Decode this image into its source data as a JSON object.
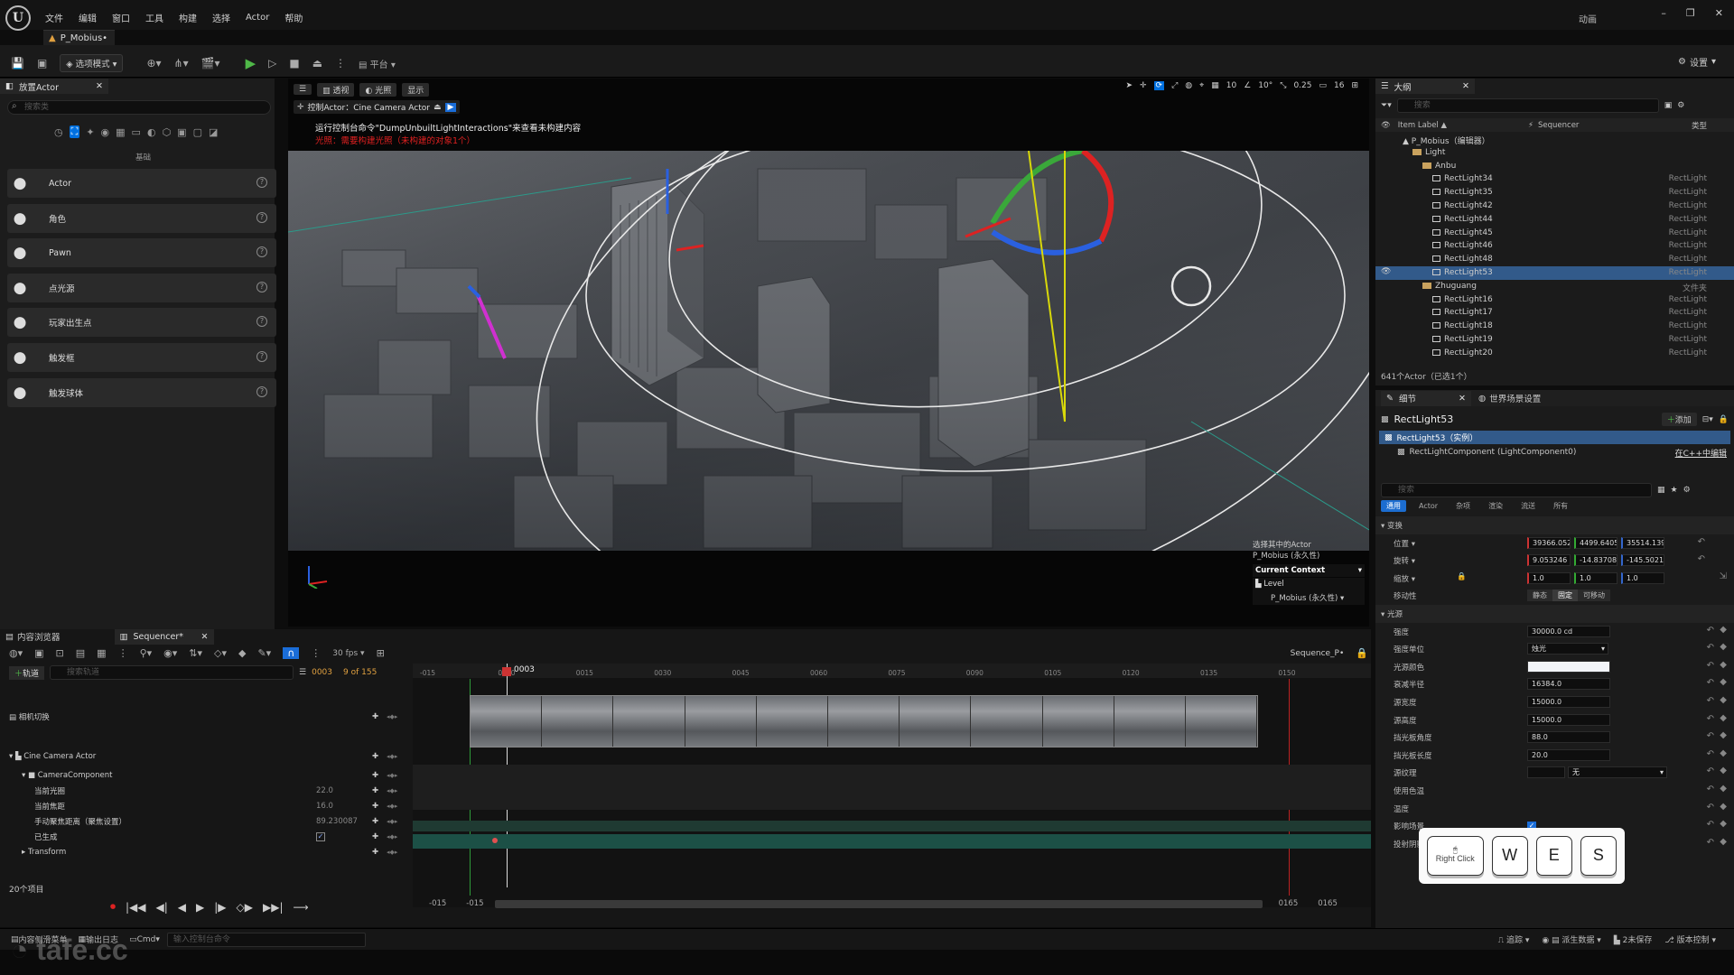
{
  "menu": [
    "文件",
    "编辑",
    "窗口",
    "工具",
    "构建",
    "选择",
    "Actor",
    "帮助"
  ],
  "doc_tab": "P_Mobius•",
  "window_mode": "动画",
  "toolbar": {
    "select_mode": "选项模式",
    "platform": "平台",
    "settings": "设置"
  },
  "place_panel": {
    "title": "放置Actor",
    "search_placeholder": "搜索类",
    "category": "基础",
    "items": [
      {
        "label": "Actor",
        "icon": "cube-icon"
      },
      {
        "label": "角色",
        "icon": "character-icon"
      },
      {
        "label": "Pawn",
        "icon": "pawn-icon"
      },
      {
        "label": "点光源",
        "icon": "point-light-icon"
      },
      {
        "label": "玩家出生点",
        "icon": "player-start-icon"
      },
      {
        "label": "触发框",
        "icon": "trigger-box-icon"
      },
      {
        "label": "触发球体",
        "icon": "trigger-sphere-icon"
      }
    ]
  },
  "viewport": {
    "perspective": "透视",
    "lit": "光照",
    "show": "显示",
    "pilot": "控制Actor：Cine Camera Actor",
    "warning": "运行控制台命令\"DumpUnbuiltLightInteractions\"来查看未构建内容",
    "error": "光照：需要构建光照（未构建的对象1个）",
    "grid": "10",
    "angle": "10°",
    "scale": "0.25",
    "camspeed": "16",
    "context": {
      "selected_title": "选择其中的Actor",
      "selected_value": "P_Mobius (永久性)",
      "header": "Current Context",
      "level_label": "Level",
      "level_value": "P_Mobius (永久性)"
    }
  },
  "outliner": {
    "title": "大纲",
    "search_placeholder": "搜索",
    "col_label": "Item Label ▲",
    "col_seq": "Sequencer",
    "col_type": "类型",
    "rows": [
      {
        "label": "P_Mobius（编辑器）",
        "type": "",
        "indent": 0,
        "kind": "world"
      },
      {
        "label": "Light",
        "type": "",
        "indent": 1,
        "kind": "folder"
      },
      {
        "label": "Anbu",
        "type": "",
        "indent": 2,
        "kind": "folder"
      },
      {
        "label": "RectLight34",
        "type": "RectLight",
        "indent": 3,
        "kind": "actor"
      },
      {
        "label": "RectLight35",
        "type": "RectLight",
        "indent": 3,
        "kind": "actor"
      },
      {
        "label": "RectLight42",
        "type": "RectLight",
        "indent": 3,
        "kind": "actor"
      },
      {
        "label": "RectLight44",
        "type": "RectLight",
        "indent": 3,
        "kind": "actor"
      },
      {
        "label": "RectLight45",
        "type": "RectLight",
        "indent": 3,
        "kind": "actor"
      },
      {
        "label": "RectLight46",
        "type": "RectLight",
        "indent": 3,
        "kind": "actor"
      },
      {
        "label": "RectLight48",
        "type": "RectLight",
        "indent": 3,
        "kind": "actor"
      },
      {
        "label": "RectLight53",
        "type": "RectLight",
        "indent": 3,
        "kind": "actor",
        "selected": true
      },
      {
        "label": "Zhuguang",
        "type": "文件夹",
        "indent": 2,
        "kind": "folder"
      },
      {
        "label": "RectLight16",
        "type": "RectLight",
        "indent": 3,
        "kind": "actor"
      },
      {
        "label": "RectLight17",
        "type": "RectLight",
        "indent": 3,
        "kind": "actor"
      },
      {
        "label": "RectLight18",
        "type": "RectLight",
        "indent": 3,
        "kind": "actor"
      },
      {
        "label": "RectLight19",
        "type": "RectLight",
        "indent": 3,
        "kind": "actor"
      },
      {
        "label": "RectLight20",
        "type": "RectLight",
        "indent": 3,
        "kind": "actor"
      }
    ],
    "footer": "641个Actor（已选1个）"
  },
  "details": {
    "tab": "细节",
    "tab2": "世界场景设置",
    "actor": "RectLight53",
    "add": "添加",
    "instance": "RectLight53（实例）",
    "component": "RectLightComponent (LightComponent0)",
    "edit_cpp": "在C++中编辑",
    "search_placeholder": "搜索",
    "filters": [
      "通用",
      "Actor",
      "杂项",
      "渲染",
      "流送",
      "所有"
    ],
    "transform_header": "变换",
    "location_label": "位置",
    "location": [
      "39366.052(",
      "4499.64054",
      "35514.139("
    ],
    "rotation_label": "旋转",
    "rotation": [
      "9.053246 °",
      "-14.83708 °",
      "-145.5021 °"
    ],
    "scale_label": "缩放",
    "scale": [
      "1.0",
      "1.0",
      "1.0"
    ],
    "mobility_label": "移动性",
    "mobility": [
      "静态",
      "固定",
      "可移动"
    ],
    "light_header": "光源",
    "props": [
      {
        "k": "强度",
        "v": "30000.0 cd"
      },
      {
        "k": "强度单位",
        "v": "烛光"
      },
      {
        "k": "光源颜色",
        "v": ""
      },
      {
        "k": "衰减半径",
        "v": "16384.0"
      },
      {
        "k": "源宽度",
        "v": "15000.0"
      },
      {
        "k": "源高度",
        "v": "15000.0"
      },
      {
        "k": "挡光板角度",
        "v": "88.0"
      },
      {
        "k": "挡光板长度",
        "v": "20.0"
      },
      {
        "k": "源纹理",
        "v": "无"
      },
      {
        "k": "使用色温",
        "v": ""
      },
      {
        "k": "温度",
        "v": ""
      },
      {
        "k": "影响场景",
        "v": ""
      },
      {
        "k": "投射阴影",
        "v": ""
      }
    ]
  },
  "bottom_tabs": {
    "content": "内容浏览器",
    "sequencer": "Sequencer*"
  },
  "sequencer": {
    "fps": "30 fps",
    "seq_name": "Sequence_P•",
    "add_track": "轨道",
    "search_placeholder": "搜索轨道",
    "current_frame": "0003",
    "frame_of": "9 of 155",
    "playhead_label": "0003",
    "ruler": [
      "-015",
      "0000",
      "0015",
      "0030",
      "0045",
      "0060",
      "0075",
      "0090",
      "0105",
      "0120",
      "0135",
      "0150"
    ],
    "range_left": [
      "-015",
      "-015"
    ],
    "range_right": [
      "0165",
      "0165"
    ],
    "items_count": "20个项目",
    "tracks": [
      {
        "label": "相机切换",
        "value": "",
        "indent": 0
      },
      {
        "label": "Cine Camera Actor",
        "value": "",
        "indent": 0
      },
      {
        "label": "CameraComponent",
        "value": "",
        "indent": 1
      },
      {
        "label": "当前光圈",
        "value": "22.0",
        "indent": 2
      },
      {
        "label": "当前焦距",
        "value": "16.0",
        "indent": 2
      },
      {
        "label": "手动聚焦距离（聚焦设置）",
        "value": "89.230087",
        "indent": 2
      },
      {
        "label": "已生成",
        "value": "",
        "indent": 2
      },
      {
        "label": "Transform",
        "value": "",
        "indent": 1
      }
    ]
  },
  "keys": {
    "right_click": "Right Click",
    "k1": "W",
    "k2": "E",
    "k3": "S"
  },
  "status": {
    "drawer": "内容侧滑菜单",
    "output": "输出日志",
    "cmd": "Cmd",
    "cmd_placeholder": "输入控制台命令",
    "trace": "追踪",
    "derived": "派生数据",
    "unsaved": "2未保存",
    "source": "版本控制"
  },
  "watermark": "tafe.cc"
}
